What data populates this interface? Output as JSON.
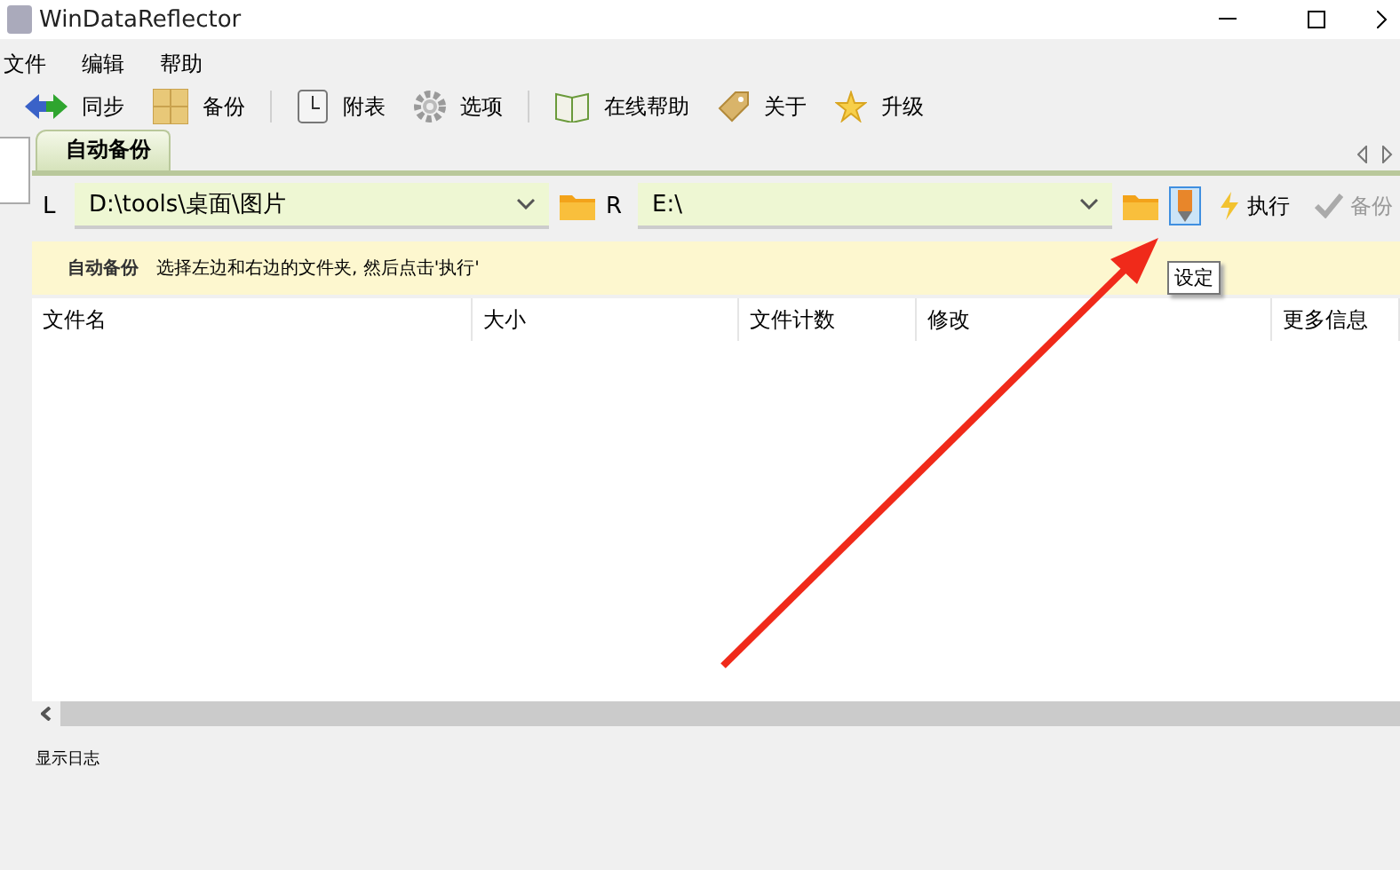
{
  "window": {
    "title": "WinDataReflector"
  },
  "menu": [
    "文件",
    "编辑",
    "帮助"
  ],
  "toolbar": [
    {
      "kind": "sync",
      "label": "同步"
    },
    {
      "kind": "backup",
      "label": "备份"
    },
    {
      "kind": "separator"
    },
    {
      "kind": "clock",
      "label": "附表"
    },
    {
      "kind": "gear",
      "label": "选项"
    },
    {
      "kind": "separator"
    },
    {
      "kind": "book",
      "label": "在线帮助"
    },
    {
      "kind": "tag",
      "label": "关于"
    },
    {
      "kind": "star",
      "label": "升级"
    }
  ],
  "tabs": [
    {
      "label": "自动备份",
      "selected": true
    }
  ],
  "left": {
    "letter": "L",
    "path": "D:\\tools\\桌面\\图片"
  },
  "right": {
    "letter": "R",
    "path": "E:\\"
  },
  "actions": [
    {
      "kind": "settings",
      "selected": true,
      "tooltip": "设定"
    },
    {
      "kind": "execute",
      "label": "执行",
      "disabled": false
    },
    {
      "kind": "check",
      "label": "备份",
      "disabled": true
    }
  ],
  "info": {
    "title": "自动备份",
    "message": "选择左边和右边的文件夹, 然后点击'执行'"
  },
  "table": {
    "columns": [
      "文件名",
      "大小",
      "文件计数",
      "修改",
      "更多信息"
    ]
  },
  "log": {
    "label": "显示日志"
  }
}
